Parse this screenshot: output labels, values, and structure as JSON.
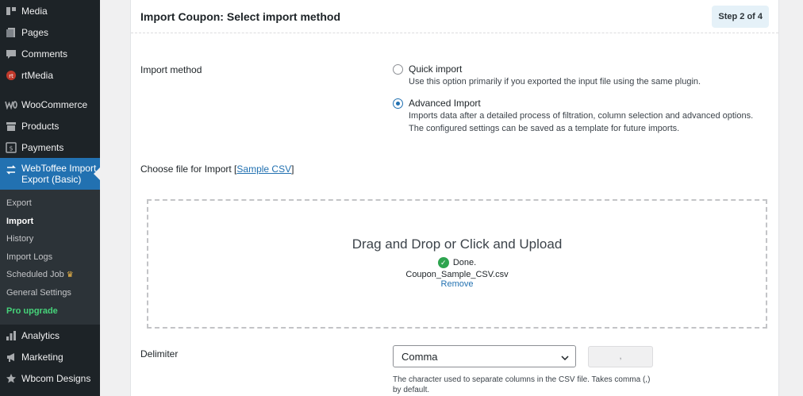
{
  "sidebar": {
    "top_items": [
      {
        "label": "Media",
        "icon": "media-icon"
      },
      {
        "label": "Pages",
        "icon": "pages-icon"
      },
      {
        "label": "Comments",
        "icon": "comments-icon"
      },
      {
        "label": "rtMedia",
        "icon": "rtmedia-icon"
      },
      {
        "label": "WooCommerce",
        "icon": "woocommerce-icon"
      },
      {
        "label": "Products",
        "icon": "products-icon"
      },
      {
        "label": "Payments",
        "icon": "payments-icon"
      }
    ],
    "active_item": {
      "label": "WebToffee Import Export (Basic)",
      "icon": "import-export-icon"
    },
    "submenu": [
      {
        "label": "Export"
      },
      {
        "label": "Import"
      },
      {
        "label": "History"
      },
      {
        "label": "Import Logs"
      },
      {
        "label": "Scheduled Job"
      },
      {
        "label": "General Settings"
      },
      {
        "label": "Pro upgrade"
      }
    ],
    "bottom_items": [
      {
        "label": "Analytics",
        "icon": "analytics-icon"
      },
      {
        "label": "Marketing",
        "icon": "megaphone-icon"
      },
      {
        "label": "Wbcom Designs",
        "icon": "star-icon"
      }
    ]
  },
  "panel": {
    "title": "Import Coupon: Select import method",
    "step": "Step 2 of 4",
    "import_method_label": "Import method",
    "options": [
      {
        "title": "Quick import",
        "desc1": "Use this option primarily if you exported the input file using the same plugin.",
        "desc2": "",
        "checked": false
      },
      {
        "title": "Advanced Import",
        "desc1": "Imports data after a detailed process of filtration, column selection and advanced options.",
        "desc2": "The configured settings can be saved as a template for future imports.",
        "checked": true
      }
    ],
    "choose_file_label": "Choose file for Import",
    "sample_csv_link": "Sample CSV",
    "dropzone": {
      "title": "Drag and Drop or Click and Upload",
      "status": "Done.",
      "filename": "Coupon_Sample_CSV.csv",
      "remove": "Remove"
    },
    "delimiter_label": "Delimiter",
    "delimiter_value": "Comma",
    "delimiter_char": ",",
    "delimiter_help": "The character used to separate columns in the CSV file. Takes comma (,) by default."
  },
  "colors": {
    "sidebar_bg": "#1d2327",
    "active_bg": "#2271b1",
    "pro_green": "#46d37a",
    "link_blue": "#2271b1"
  }
}
